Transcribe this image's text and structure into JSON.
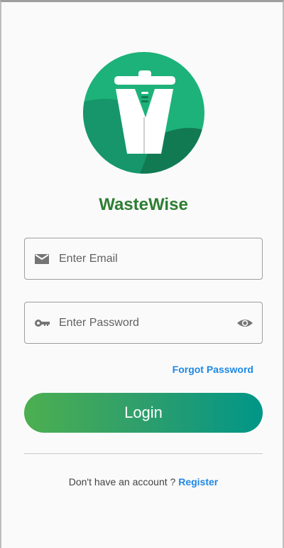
{
  "app": {
    "name": "WasteWise",
    "logo_icon": "recycling-bin-logo"
  },
  "form": {
    "email": {
      "placeholder": "Enter Email",
      "value": "",
      "icon": "mail-icon"
    },
    "password": {
      "placeholder": "Enter Password",
      "value": "",
      "icon": "key-icon",
      "toggle_icon": "eye-icon"
    },
    "forgot_label": "Forgot Password",
    "login_label": "Login"
  },
  "footer": {
    "prompt": "Don't have an account ?",
    "register_label": "Register"
  },
  "colors": {
    "brand": "#2e7d32",
    "link": "#1e88e5",
    "gradient_start": "#4caf50",
    "gradient_end": "#009688",
    "logo_bg": "#1db27a",
    "logo_dark": "#127a53"
  }
}
